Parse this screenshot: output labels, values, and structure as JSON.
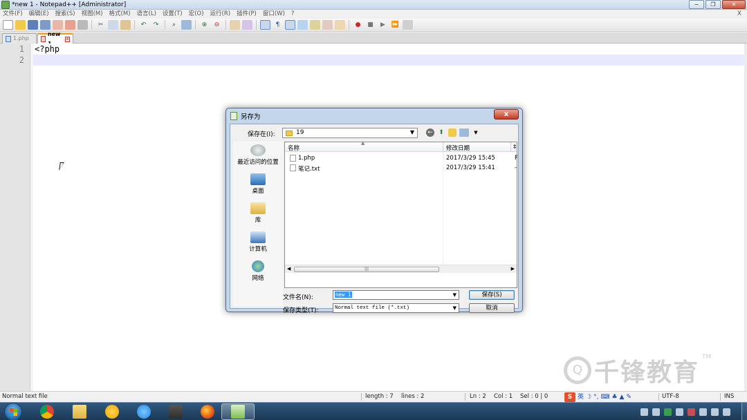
{
  "window": {
    "title": "*new 1 - Notepad++ [Administrator]",
    "controls": {
      "minimize": "−",
      "maximize": "❐",
      "close": "✕"
    }
  },
  "menu": {
    "items": [
      "文件(F)",
      "编辑(E)",
      "搜索(S)",
      "视图(M)",
      "格式(M)",
      "语言(L)",
      "设置(T)",
      "宏(O)",
      "运行(R)",
      "插件(P)",
      "窗口(W)",
      "?"
    ],
    "close_glyph": "X"
  },
  "tabs": [
    {
      "label": "1.php",
      "active": false
    },
    {
      "label": "new 1",
      "active": true
    }
  ],
  "editor": {
    "line_numbers": [
      "1",
      "2"
    ],
    "lines": [
      "<?php",
      ""
    ],
    "current_line_color": "#e8e8ff"
  },
  "watermark": {
    "logo_glyph": "Q",
    "text": "千锋教育",
    "tm": "TM"
  },
  "statusbar": {
    "file_type": "Normal text file",
    "length": "length : 7",
    "lines": "lines : 2",
    "ln": "Ln : 2",
    "col": "Col : 1",
    "sel": "Sel : 0 | 0",
    "ime_logo": "S",
    "ime_lang": "英",
    "encoding": "UTF-8",
    "mode": "INS"
  },
  "dialog": {
    "title": "另存为",
    "close_glyph": "x",
    "save_in_label": "保存在(I):",
    "save_in_value": "19",
    "places": [
      "最近访问的位置",
      "桌面",
      "库",
      "计算机",
      "网络"
    ],
    "columns": {
      "name": "名称",
      "date": "修改日期"
    },
    "files": [
      {
        "name": "1.php",
        "date": "2017/3/29 15:45"
      },
      {
        "name": "笔记.txt",
        "date": "2017/3/29 15:41"
      }
    ],
    "filename_label": "文件名(N):",
    "filename_value": "new 1",
    "filetype_label": "保存类型(T):",
    "filetype_value": "Normal text file (*.txt)",
    "save_button": "保存(S)",
    "cancel_button": "取消"
  },
  "colors": {
    "accent_tab": "#f39c12",
    "selection": "#3399ff",
    "taskbar": "#1b3957"
  }
}
